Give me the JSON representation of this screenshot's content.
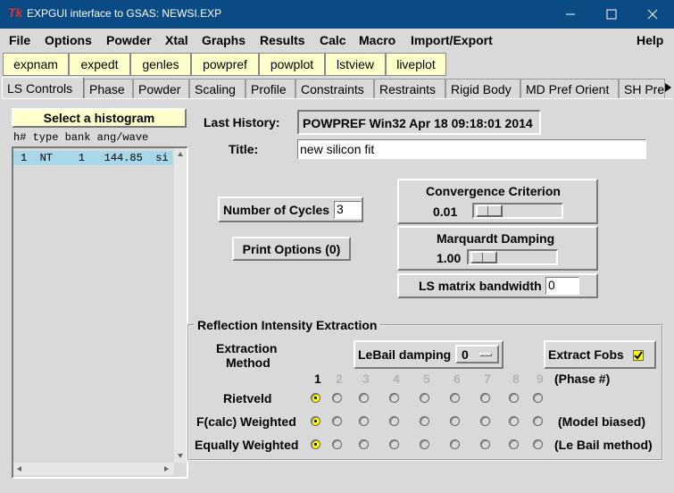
{
  "window": {
    "title": "EXPGUI interface to GSAS: NEWSI.EXP",
    "app_glyph": "Tk",
    "minimize_icon": "minimize-icon",
    "maximize_icon": "maximize-icon",
    "close_icon": "close-icon"
  },
  "menubar": [
    "File",
    "Options",
    "Powder",
    "Xtal",
    "Graphs",
    "Results",
    "Calc",
    "Macro",
    "Import/Export",
    "Help"
  ],
  "toolbar": [
    "expnam",
    "expedt",
    "genles",
    "powpref",
    "powplot",
    "lstview",
    "liveplot"
  ],
  "tabs": [
    "LS Controls",
    "Phase",
    "Powder",
    "Scaling",
    "Profile",
    "Constraints",
    "Restraints",
    "Rigid Body",
    "MD Pref Orient",
    "SH Pref"
  ],
  "histogram": {
    "button": "Select a histogram",
    "header": "h# type bank ang/wave",
    "rows": [
      "1  NT    1   144.85  si"
    ]
  },
  "last_history": {
    "label": "Last History:",
    "value": "POWPREF Win32  Apr 18 09:18:01 2014"
  },
  "title_field": {
    "label": "Title:",
    "value": "new silicon fit"
  },
  "cycles": {
    "label": "Number of Cycles",
    "value": "3"
  },
  "print_options": "Print Options (0)",
  "convergence": {
    "label": "Convergence Criterion",
    "value": "0.01"
  },
  "marquardt": {
    "label": "Marquardt Damping",
    "value": "1.00"
  },
  "bandwidth": {
    "label": "LS matrix bandwidth",
    "value": "0"
  },
  "extraction": {
    "group_title": "Reflection Intensity Extraction",
    "method_label_1": "Extraction",
    "method_label_2": "Method",
    "lebail_label": "LeBail damping",
    "lebail_value": "0",
    "extract_fobs": "Extract Fobs",
    "extract_fobs_checked": true,
    "phases": [
      "1",
      "2",
      "3",
      "4",
      "5",
      "6",
      "7",
      "8",
      "9"
    ],
    "phase_note": "(Phase #)",
    "rows": [
      {
        "label": "Rietveld",
        "note": "",
        "selected": [
          true,
          false,
          false,
          false,
          false,
          false,
          false,
          false,
          false
        ]
      },
      {
        "label": "F(calc) Weighted",
        "note": "(Model biased)",
        "selected": [
          true,
          false,
          false,
          false,
          false,
          false,
          false,
          false,
          false
        ]
      },
      {
        "label": "Equally Weighted",
        "note": "(Le Bail method)",
        "selected": [
          true,
          false,
          false,
          false,
          false,
          false,
          false,
          false,
          false
        ]
      }
    ]
  }
}
